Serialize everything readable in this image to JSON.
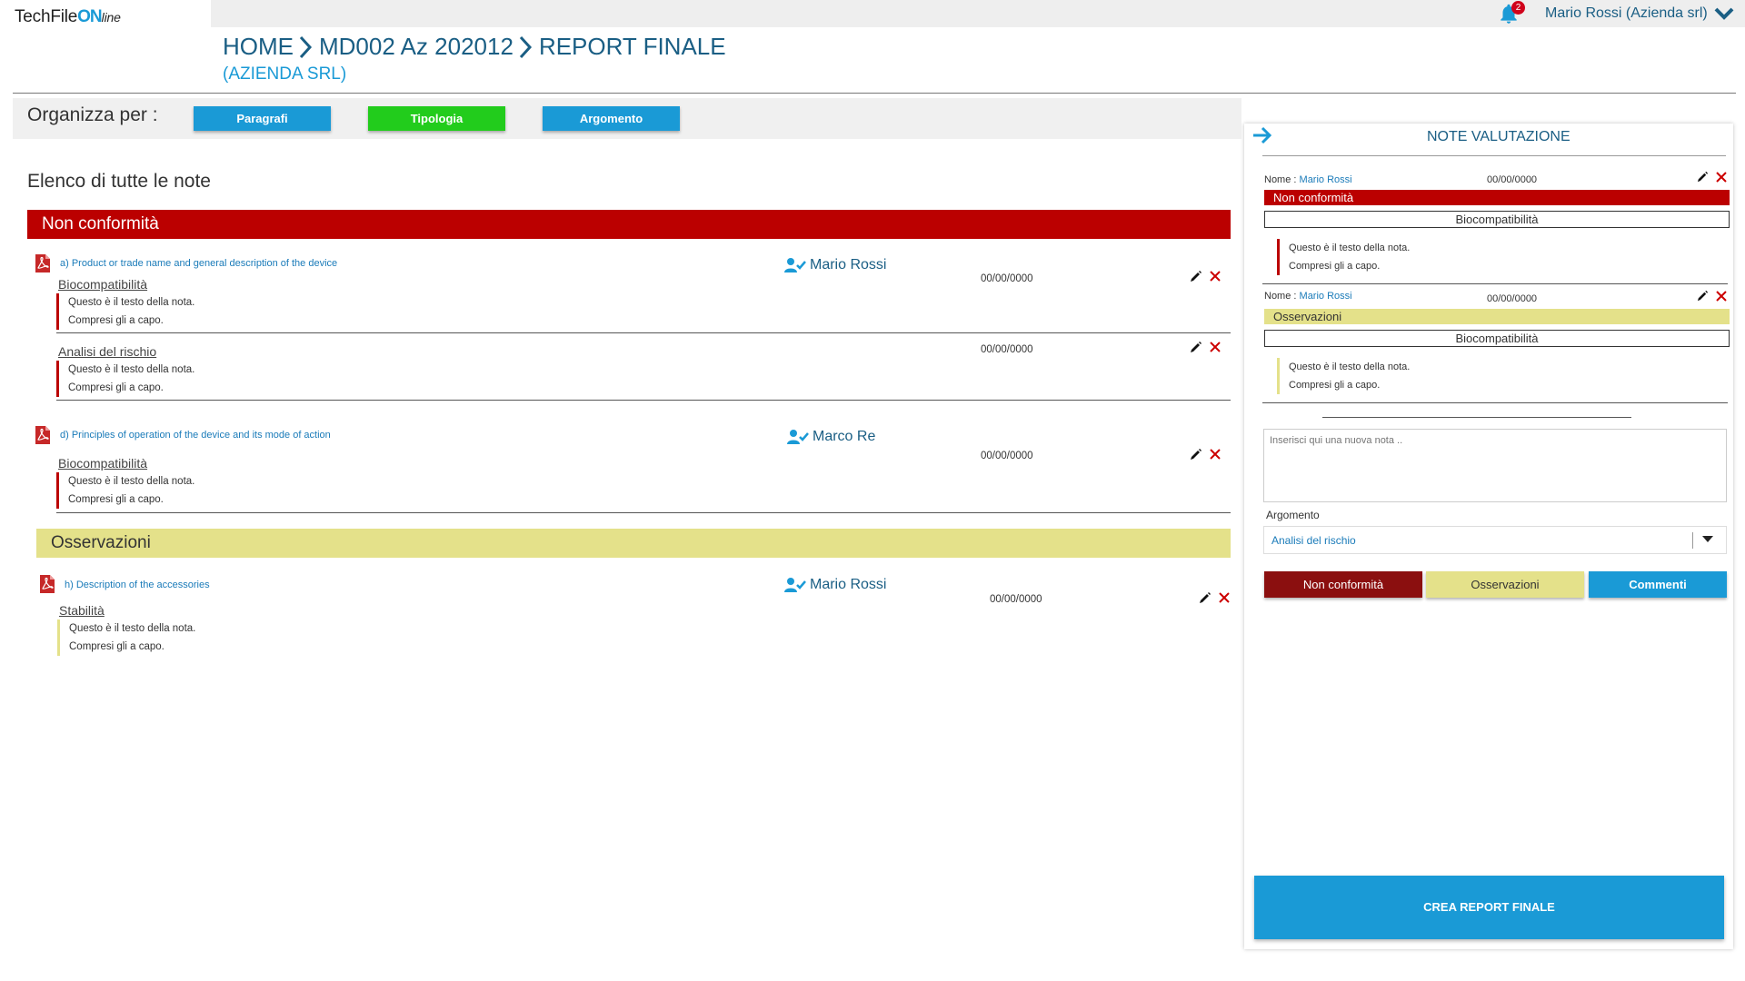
{
  "app": {
    "logo_prefix": "TechFile",
    "logo_on": "ON",
    "logo_suffix": "line",
    "notifications_count": "2",
    "user_label": "Mario Rossi (Azienda srl)"
  },
  "breadcrumb": {
    "items": [
      "HOME",
      "MD002 Az 202012",
      "REPORT FINALE"
    ],
    "subtitle": "(AZIENDA SRL)"
  },
  "organize": {
    "label": "Organizza per :",
    "buttons": [
      {
        "label": "Paragrafi",
        "color": "#1a9ad6"
      },
      {
        "label": "Tipologia",
        "color": "#22cc1c"
      },
      {
        "label": "Argomento",
        "color": "#1a9ad6"
      }
    ]
  },
  "main": {
    "title": "Elenco di tutte le note",
    "sections": {
      "nc_title": "Non conformità",
      "oss_title": "Osservazioni"
    },
    "entries": [
      {
        "paragraph": "a) Product or trade name and general description of the device",
        "author": "Mario Rossi",
        "notes": [
          {
            "topic": "Biocompatibilità",
            "line1": "Questo è il testo della nota.",
            "line2": "Compresi gli a capo.",
            "date": "00/00/0000"
          },
          {
            "topic": "Analisi del rischio",
            "line1": "Questo è il testo della nota.",
            "line2": "Compresi gli a capo.",
            "date": "00/00/0000"
          }
        ]
      },
      {
        "paragraph": "d) Principles of operation of the device and its mode of action",
        "author": "Marco Re",
        "notes": [
          {
            "topic": "Biocompatibilità",
            "line1": "Questo è il testo della nota.",
            "line2": "Compresi gli a capo.",
            "date": "00/00/0000"
          }
        ]
      },
      {
        "paragraph": "h) Description of the accessories",
        "author": "Mario Rossi",
        "notes": [
          {
            "topic": "Stabilità",
            "line1": "Questo è il testo della nota.",
            "line2": "Compresi gli a capo.",
            "date": "00/00/0000"
          }
        ]
      }
    ]
  },
  "panel": {
    "title": "NOTE VALUTAZIONE",
    "nome_label": "Nome :",
    "notes": [
      {
        "name": "Mario Rossi",
        "date": "00/00/0000",
        "type": "Non conformità",
        "topic": "Biocompatibilità",
        "line1": "Questo è il testo della nota.",
        "line2": "Compresi gli a capo."
      },
      {
        "name": "Mario Rossi",
        "date": "00/00/0000",
        "type": "Osservazioni",
        "topic": "Biocompatibilità",
        "line1": "Questo è il testo della nota.",
        "line2": "Compresi gli a capo."
      }
    ],
    "new_note_placeholder": "Inserisci qui una nuova nota ..",
    "argomento_label": "Argomento",
    "argomento_value": "Analisi del rischio",
    "buttons": {
      "nc": "Non conformità",
      "oss": "Osservazioni",
      "comm": "Commenti"
    },
    "create_report": "CREA REPORT FINALE"
  },
  "colors": {
    "nc": "#bb0000",
    "nc_button": "#8b0f0f",
    "oss": "#e4e18a",
    "primary": "#1a9ad6",
    "heading": "#1a5e84"
  }
}
